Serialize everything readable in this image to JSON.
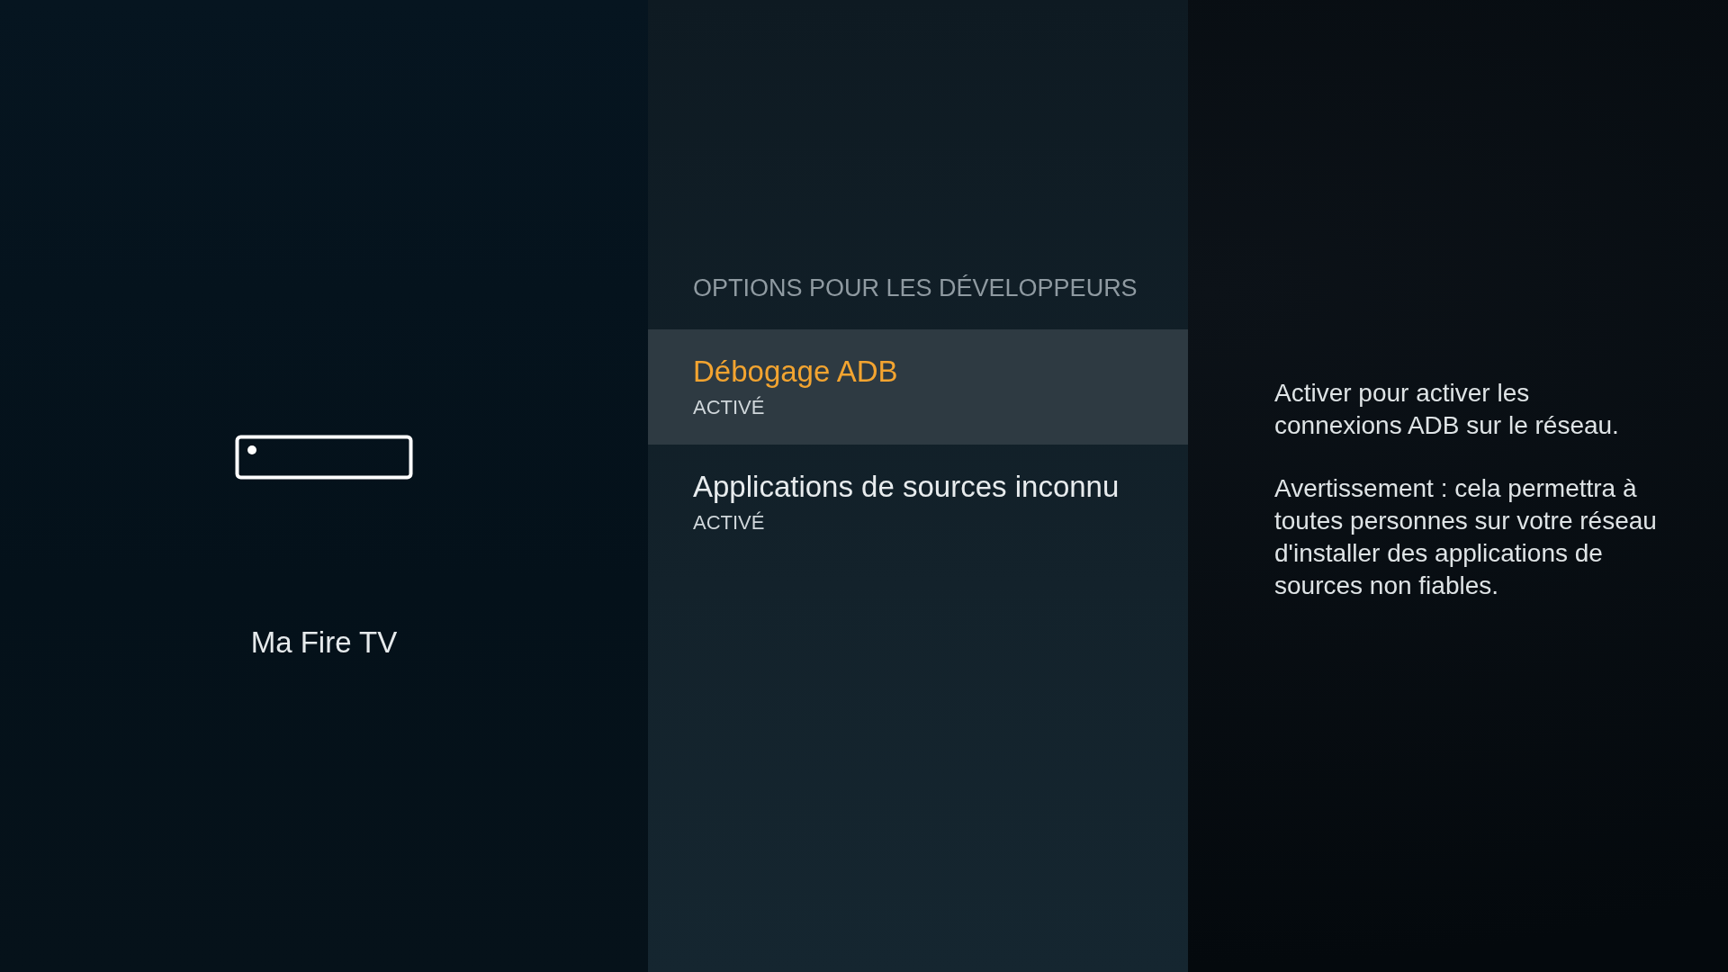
{
  "device": {
    "name": "Ma Fire TV"
  },
  "menu": {
    "title": "OPTIONS POUR LES DÉVELOPPEURS",
    "items": [
      {
        "label": "Débogage ADB",
        "status": "ACTIVÉ",
        "selected": true
      },
      {
        "label": "Applications de sources inconnu",
        "status": "ACTIVÉ",
        "selected": false
      }
    ]
  },
  "description": [
    "Activer pour activer les connexions ADB sur le réseau.",
    "Avertissement : cela permettra à toutes personnes sur votre réseau d'installer des applications de sources non fiables."
  ]
}
